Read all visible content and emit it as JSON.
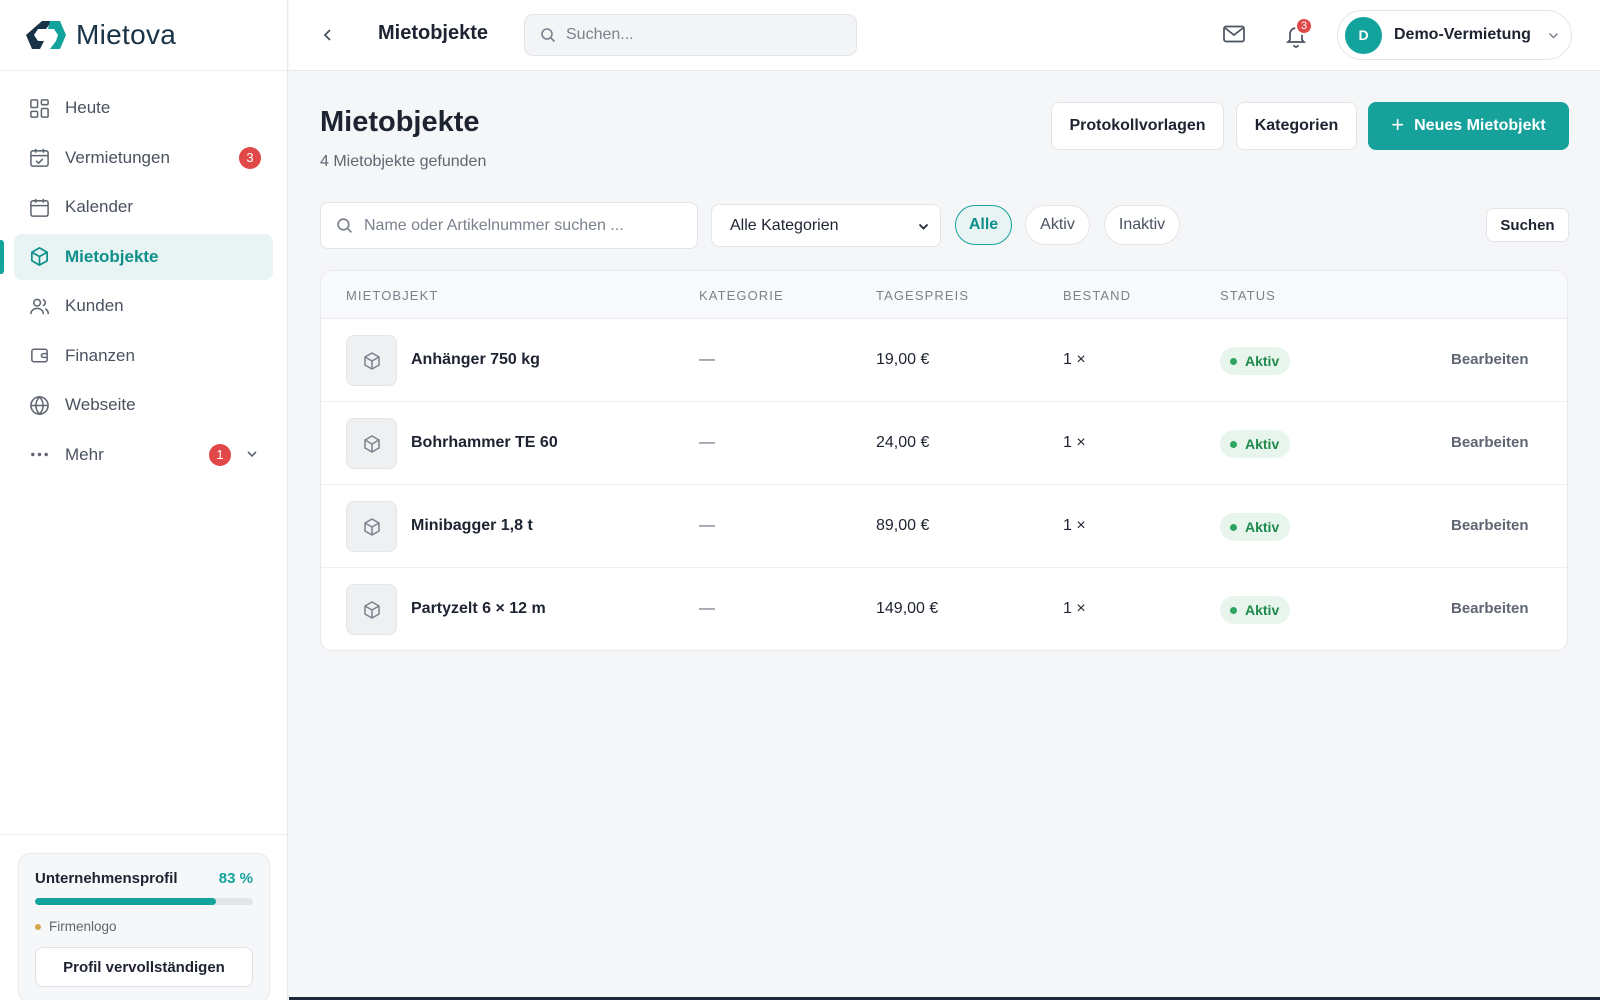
{
  "app": {
    "name": "Mietova"
  },
  "sidebar": {
    "items": [
      {
        "label": "Heute",
        "icon": "grid-icon"
      },
      {
        "label": "Vermietungen",
        "icon": "calendar-check-icon",
        "badge": "3"
      },
      {
        "label": "Kalender",
        "icon": "calendar-icon"
      },
      {
        "label": "Mietobjekte",
        "icon": "cube-icon",
        "active": true
      },
      {
        "label": "Kunden",
        "icon": "users-icon"
      },
      {
        "label": "Finanzen",
        "icon": "wallet-icon"
      },
      {
        "label": "Webseite",
        "icon": "globe-icon"
      },
      {
        "label": "Mehr",
        "icon": "more-dots-icon",
        "badge": "1"
      }
    ],
    "profile": {
      "title": "Unternehmensprofil",
      "percent_label": "83 %",
      "progress": 0.83,
      "hint": "Firmenlogo",
      "button": "Profil vervollständigen"
    }
  },
  "topbar": {
    "title": "Mietobjekte",
    "search_placeholder": "Suchen...",
    "notification_count": "3",
    "account_initial": "D",
    "account_name": "Demo-Vermietung"
  },
  "page": {
    "title": "Mietobjekte",
    "subtitle": "4 Mietobjekte gefunden",
    "buttons": {
      "templates": "Protokollvorlagen",
      "categories": "Kategorien",
      "new_item": "Neues Mietobjekt"
    },
    "filters": {
      "search_placeholder": "Name oder Artikelnummer suchen ...",
      "category": "Alle Kategorien",
      "chips": [
        "Alle",
        "Aktiv",
        "Inaktiv"
      ],
      "active_chip": "Alle",
      "search_button": "Suchen"
    }
  },
  "table": {
    "headers": [
      "MIETOBJEKT",
      "KATEGORIE",
      "TAGESPREIS",
      "BESTAND",
      "STATUS"
    ],
    "rows": [
      {
        "name": "Anhänger 750 kg",
        "category": "—",
        "price": "19,00 €",
        "stock": "1 ×",
        "status": "Aktiv",
        "action": "Bearbeiten"
      },
      {
        "name": "Bohrhammer TE 60",
        "category": "—",
        "price": "24,00 €",
        "stock": "1 ×",
        "status": "Aktiv",
        "action": "Bearbeiten"
      },
      {
        "name": "Minibagger 1,8 t",
        "category": "—",
        "price": "89,00 €",
        "stock": "1 ×",
        "status": "Aktiv",
        "action": "Bearbeiten"
      },
      {
        "name": "Partyzelt 6 × 12 m",
        "category": "—",
        "price": "149,00 €",
        "stock": "1 ×",
        "status": "Aktiv",
        "action": "Bearbeiten"
      }
    ]
  },
  "colors": {
    "accent": "#16a19b",
    "badge": "#e14848",
    "status_active": "#1e8a4c"
  }
}
